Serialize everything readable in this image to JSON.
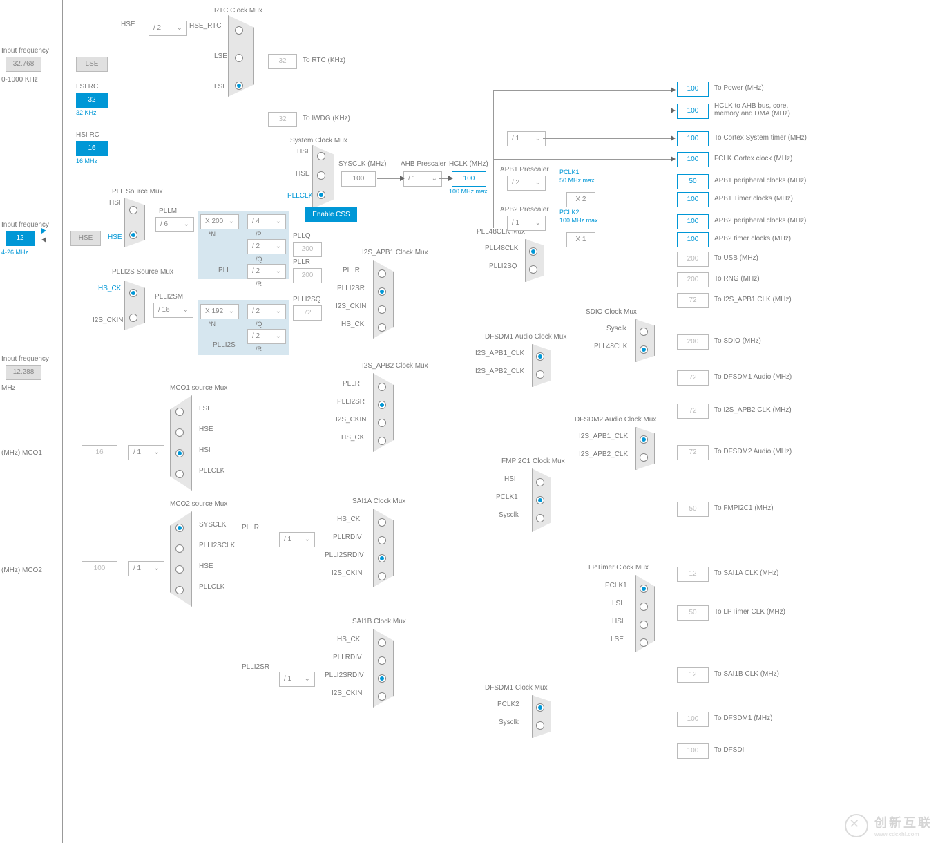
{
  "left": {
    "lse_freq_label": "Input frequency",
    "lse_freq": "32.768",
    "lse_range": "0-1000 KHz",
    "hse_freq_label": "Input frequency",
    "hse_freq": "12",
    "hse_range": "4-26 MHz",
    "i2s_freq_label": "Input frequency",
    "i2s_freq": "12.288",
    "i2s_unit": "MHz",
    "mco1_label": "(MHz) MCO1",
    "mco2_label": "(MHz) MCO2"
  },
  "sources": {
    "lse": "LSE",
    "hse": "HSE",
    "lsi_rc": "LSI RC",
    "lsi_val": "32",
    "lsi_note": "32 KHz",
    "hsi_rc": "HSI RC",
    "hsi_val": "16",
    "hsi_note": "16 MHz"
  },
  "rtc": {
    "title": "RTC Clock Mux",
    "hse": "HSE",
    "hse_div": "/ 2",
    "hse_rtc": "HSE_RTC",
    "lse": "LSE",
    "lsi": "LSI",
    "to_rtc_val": "32",
    "to_rtc": "To RTC (KHz)",
    "to_iwdg_val": "32",
    "to_iwdg": "To IWDG (KHz)"
  },
  "sysclk": {
    "title": "System Clock Mux",
    "hsi": "HSI",
    "hse": "HSE",
    "pllclk": "PLLCLK",
    "enable_css": "Enable CSS",
    "sysclk_label": "SYSCLK (MHz)",
    "sysclk_val": "100",
    "ahb_label": "AHB Prescaler",
    "ahb": "/ 1",
    "hclk_label": "HCLK (MHz)",
    "hclk_val": "100",
    "hclk_note": "100 MHz max"
  },
  "plls": {
    "pll_src_title": "PLL Source Mux",
    "hsi": "HSI",
    "hse": "HSE",
    "pllm_label": "PLLM",
    "pllm": "/ 6",
    "pll_title": "PLL",
    "plln": "X 200",
    "plln_label": "*N",
    "pllp": "/ 4",
    "pllp_label": "/P",
    "pllq": "/ 2",
    "pllq_label": "/Q",
    "pllq_out": "PLLQ",
    "pllq_val": "200",
    "pllr": "/ 2",
    "pllr_label": "/R",
    "pllr_out": "PLLR",
    "pllr_val": "200",
    "plli2s_src_title": "PLLI2S Source Mux",
    "hs_ck": "HS_CK",
    "i2s_ckin": "I2S_CKIN",
    "plli2sm_label": "PLLI2SM",
    "plli2sm": "/ 16",
    "plli2s_title": "PLLI2S",
    "plli2sn": "X 192",
    "plli2sn_label": "*N",
    "plli2sq": "/ 2",
    "plli2sq_label": "/Q",
    "plli2sq_out": "PLLI2SQ",
    "plli2sq_val": "72",
    "plli2sr": "/ 2",
    "plli2sr_label": "/R"
  },
  "mco": {
    "mco1_title": "MCO1 source Mux",
    "mco1_opts": [
      "LSE",
      "HSE",
      "HSI",
      "PLLCLK"
    ],
    "mco1_div": "/ 1",
    "mco1_val": "16",
    "mco2_title": "MCO2 source Mux",
    "mco2_opts": [
      "SYSCLK",
      "PLLI2SCLK",
      "HSE",
      "PLLCLK"
    ],
    "mco2_div": "/ 1",
    "mco2_val": "100"
  },
  "i2s_apb1": {
    "title": "I2S_APB1 Clock Mux",
    "opts": [
      "PLLR",
      "PLLI2SR",
      "I2S_CKIN",
      "HS_CK"
    ]
  },
  "i2s_apb2": {
    "title": "I2S_APB2 Clock Mux",
    "opts": [
      "PLLR",
      "PLLI2SR",
      "I2S_CKIN",
      "HS_CK"
    ]
  },
  "sai1a": {
    "title": "SAI1A Clock Mux",
    "opts": [
      "HS_CK",
      "PLLRDIV",
      "PLLI2SRDIV",
      "I2S_CKIN"
    ],
    "pllr": "PLLR",
    "pllr_div": "/ 1",
    "plli2sr": "PLLI2SR",
    "plli2sr_div": "/ 1"
  },
  "sai1b": {
    "title": "SAI1B Clock Mux",
    "opts": [
      "HS_CK",
      "PLLRDIV",
      "PLLI2SRDIV",
      "I2S_CKIN"
    ]
  },
  "right": {
    "power_val": "100",
    "power": "To Power (MHz)",
    "hclk_val": "100",
    "hclk": "HCLK to AHB bus, core, memory and DMA (MHz)",
    "cortex_div": "/ 1",
    "cortex_val": "100",
    "cortex": "To Cortex System timer (MHz)",
    "fclk_val": "100",
    "fclk": "FCLK Cortex clock (MHz)",
    "apb1_label": "APB1 Prescaler",
    "apb1_div": "/ 2",
    "pclk1_label": "PCLK1",
    "pclk1_note": "50 MHz max",
    "apb1p_val": "50",
    "apb1p": "APB1 peripheral clocks (MHz)",
    "apb1t_mul": "X 2",
    "apb1t_val": "100",
    "apb1t": "APB1 Timer clocks (MHz)",
    "apb2_label": "APB2 Prescaler",
    "apb2_div": "/ 1",
    "pclk2_label": "PCLK2",
    "pclk2_note": "100 MHz max",
    "apb2p_val": "100",
    "apb2p": "APB2 peripheral clocks (MHz)",
    "apb2t_mul": "X 1",
    "apb2t_val": "100",
    "apb2t": "APB2 timer clocks (MHz)",
    "usb_val": "200",
    "usb": "To USB (MHz)",
    "rng_val": "200",
    "rng": "To RNG (MHz)",
    "i2sapb1_val": "72",
    "i2sapb1": "To I2S_APB1 CLK (MHz)",
    "sdio_val": "200",
    "sdio": "To SDIO (MHz)",
    "dfsdm1a_val": "72",
    "dfsdm1a": "To DFSDM1 Audio (MHz)",
    "i2sapb2_val": "72",
    "i2sapb2": "To I2S_APB2 CLK (MHz)",
    "dfsdm2a_val": "72",
    "dfsdm2a": "To DFSDM2 Audio (MHz)",
    "fmpi2c_val": "50",
    "fmpi2c": "To FMPI2C1 (MHz)",
    "sai1a_val": "12",
    "sai1a": "To SAI1A CLK (MHz)",
    "lptimer_val": "50",
    "lptimer": "To LPTimer CLK (MHz)",
    "sai1b_val": "12",
    "sai1b": "To SAI1B CLK (MHz)",
    "dfsdm1_val": "100",
    "dfsdm1": "To DFSDM1 (MHz)",
    "dfsdm2_val": "100",
    "dfsdm2": "To DFSDI"
  },
  "pll48": {
    "title": "PLL48CLK Mux",
    "a": "PLL48CLK",
    "b": "PLLI2SQ"
  },
  "sdio_mux": {
    "title": "SDIO Clock Mux",
    "a": "Sysclk",
    "b": "PLL48CLK"
  },
  "dfsdm1a_mux": {
    "title": "DFSDM1 Audio Clock Mux",
    "a": "I2S_APB1_CLK",
    "b": "I2S_APB2_CLK"
  },
  "dfsdm2a_mux": {
    "title": "DFSDM2 Audio Clock Mux",
    "a": "I2S_APB1_CLK",
    "b": "I2S_APB2_CLK"
  },
  "fmpi2c_mux": {
    "title": "FMPI2C1 Clock Mux",
    "opts": [
      "HSI",
      "PCLK1",
      "Sysclk"
    ]
  },
  "lptimer_mux": {
    "title": "LPTimer Clock Mux",
    "opts": [
      "PCLK1",
      "LSI",
      "HSI",
      "LSE"
    ]
  },
  "dfsdm1_mux": {
    "title": "DFSDM1 Clock Mux",
    "a": "PCLK2",
    "b": "Sysclk"
  },
  "watermark": {
    "name": "创新互联",
    "sub": "www.cdcxhl.com"
  }
}
